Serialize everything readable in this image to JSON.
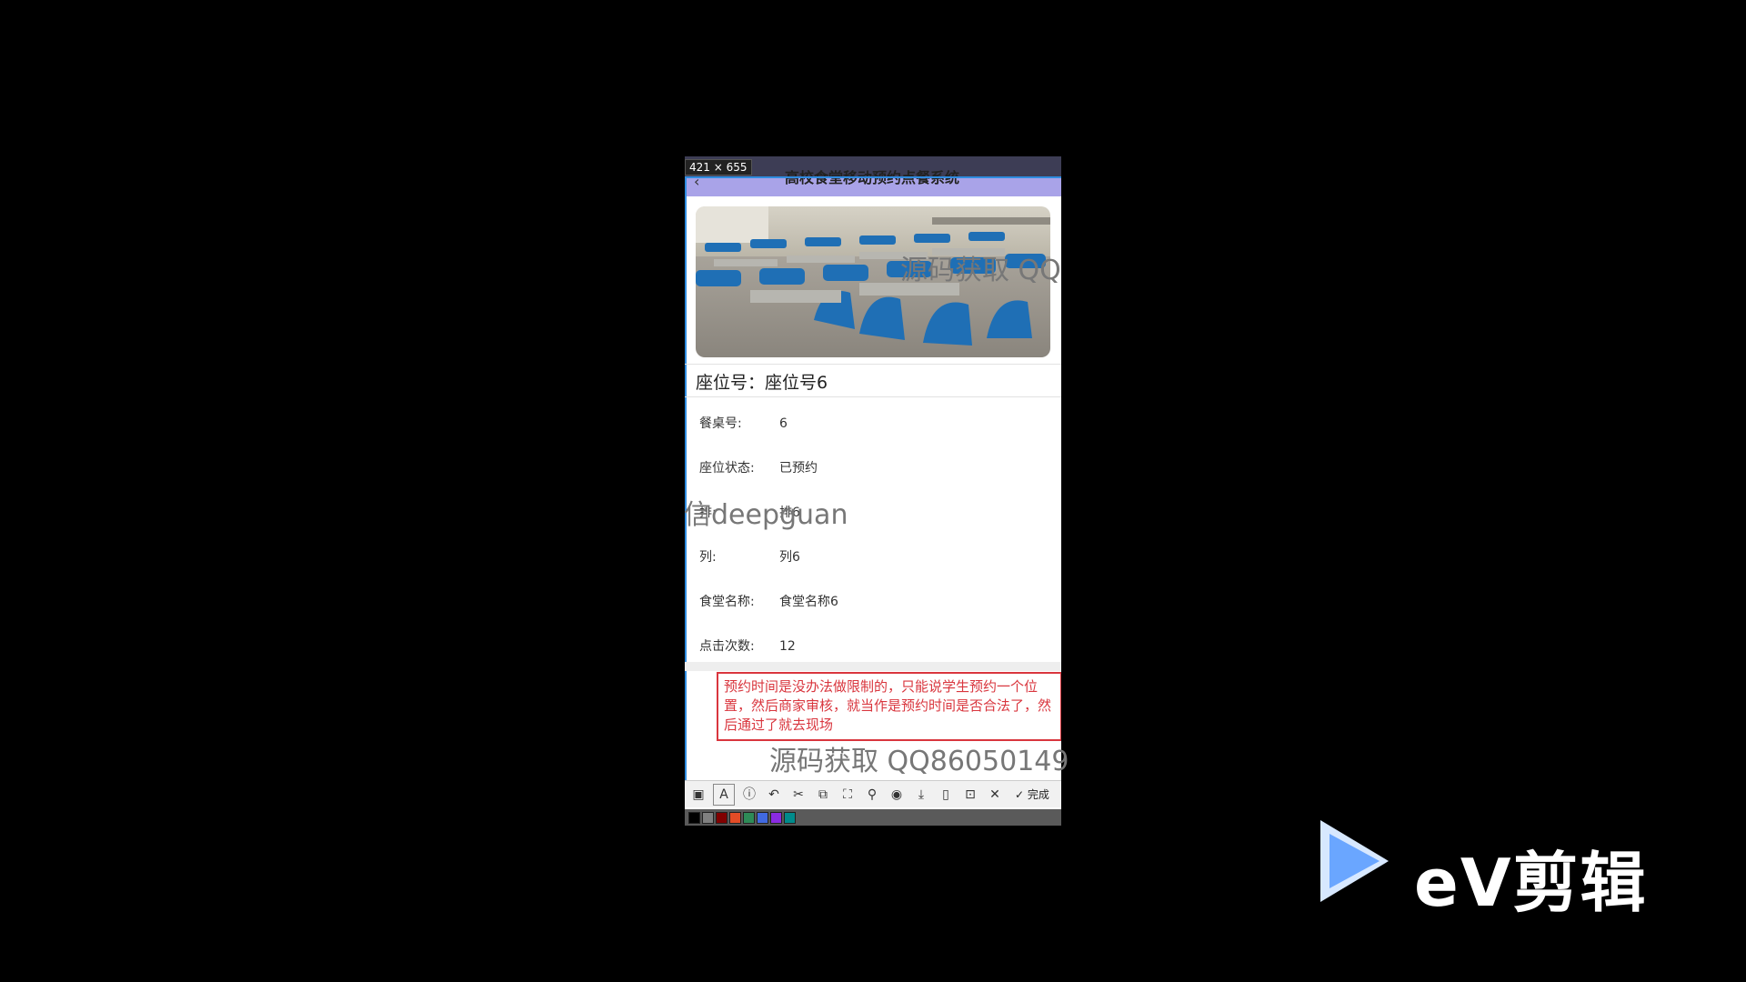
{
  "app": {
    "size_badge": "421 × 655",
    "title": "高校食堂移动预约点餐系统"
  },
  "seat": {
    "title": "座位号：座位号6",
    "fields": [
      {
        "label": "餐桌号:",
        "value": "6"
      },
      {
        "label": "座位状态:",
        "value": "已预约"
      },
      {
        "label": "排:",
        "value": "排6"
      },
      {
        "label": "列:",
        "value": "列6"
      },
      {
        "label": "食堂名称:",
        "value": "食堂名称6"
      },
      {
        "label": "点击次数:",
        "value": "12"
      }
    ]
  },
  "note": "预约时间是没办法做限制的，只能说学生预约一个位置，然后商家审核，就当作是预约时间是否合法了，然后通过了就去现场",
  "watermarks": {
    "top": "源码获取 QQ",
    "middle": "信deepguan",
    "bottom": "源码获取 QQ86050149"
  },
  "toolbar": {
    "done_label": "完成",
    "icons": [
      "mosaic-icon",
      "text-icon",
      "number-icon",
      "undo-icon",
      "crop-icon",
      "translate-icon",
      "screenshot-icon",
      "pin-icon",
      "record-icon",
      "download-icon",
      "save-icon",
      "bookmark-icon",
      "close-icon"
    ]
  },
  "palette": [
    "#000000",
    "#808080",
    "#800000",
    "#e34c26",
    "#2e8b57",
    "#4169e1",
    "#8a2be2",
    "#008b8b"
  ],
  "branding": {
    "logo_text": "eV剪辑",
    "logo_colors": {
      "play": "#6aa6ff",
      "play_light": "#d7e8ff"
    }
  },
  "colors": {
    "appbar": "#a9a3e8",
    "note_border": "#d9363e",
    "selection": "#2f8ce0"
  }
}
